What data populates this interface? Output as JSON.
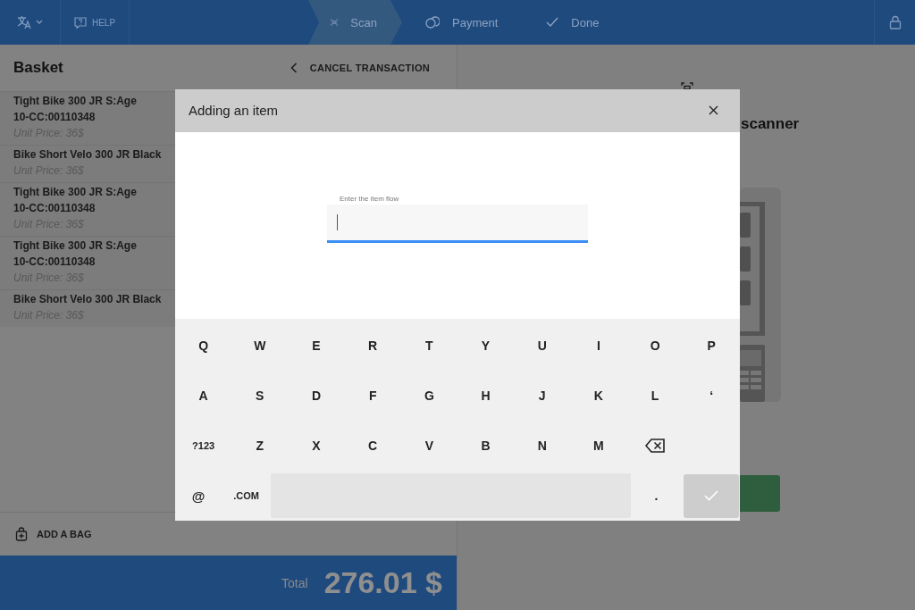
{
  "top_bar": {
    "language_button": {
      "kind": "language"
    },
    "help_button": {
      "label": "HELP"
    },
    "steps": [
      {
        "kind": "scan",
        "label": "Scan",
        "selected": true
      },
      {
        "kind": "payment",
        "label": "Payment",
        "selected": false
      },
      {
        "kind": "done",
        "label": "Done",
        "selected": false
      }
    ],
    "lock_button": {
      "kind": "lock"
    }
  },
  "basket": {
    "title": "Basket",
    "cancel": "CANCEL TRANSACTION",
    "items": [
      {
        "name": "Tight Bike 300 JR S:Age\n10-CC:00110348",
        "price": "Unit Price: 36$"
      },
      {
        "name": "Bike Short Velo 300 JR Black",
        "price": "Unit Price: 36$"
      },
      {
        "name": "Tight Bike 300 JR S:Age\n10-CC:00110348",
        "price": "Unit Price: 36$"
      },
      {
        "name": "Tight Bike 300 JR S:Age\n10-CC:00110348",
        "price": "Unit Price: 36$"
      },
      {
        "name": "Bike Short Velo 300 JR Black",
        "price": "Unit Price: 36$"
      }
    ],
    "add_bag": "ADD A BAG",
    "total_label": "Total",
    "total": "276.01 $"
  },
  "scan_panel": {
    "title": "scanner"
  },
  "dialog": {
    "title": "Adding an item",
    "field": {
      "label": "Enter the item flow",
      "focused": true
    },
    "keyboard": {
      "rows": [
        [
          {
            "kind": "char",
            "label": "Q"
          },
          {
            "kind": "char",
            "label": "W"
          },
          {
            "kind": "char",
            "label": "E"
          },
          {
            "kind": "char",
            "label": "R"
          },
          {
            "kind": "char",
            "label": "T"
          },
          {
            "kind": "char",
            "label": "Y"
          },
          {
            "kind": "char",
            "label": "U"
          },
          {
            "kind": "char",
            "label": "I"
          },
          {
            "kind": "char",
            "label": "O"
          },
          {
            "kind": "char",
            "label": "P"
          }
        ],
        [
          {
            "kind": "char",
            "label": "A"
          },
          {
            "kind": "char",
            "label": "S"
          },
          {
            "kind": "char",
            "label": "D"
          },
          {
            "kind": "char",
            "label": "F"
          },
          {
            "kind": "char",
            "label": "G"
          },
          {
            "kind": "char",
            "label": "H"
          },
          {
            "kind": "char",
            "label": "J"
          },
          {
            "kind": "char",
            "label": "K"
          },
          {
            "kind": "char",
            "label": "L"
          },
          {
            "kind": "char",
            "label": "‘"
          }
        ],
        [
          {
            "kind": "mode",
            "label": "?123"
          },
          {
            "kind": "char",
            "label": "Z"
          },
          {
            "kind": "char",
            "label": "X"
          },
          {
            "kind": "char",
            "label": "C"
          },
          {
            "kind": "char",
            "label": "V"
          },
          {
            "kind": "char",
            "label": "B"
          },
          {
            "kind": "char",
            "label": "N"
          },
          {
            "kind": "char",
            "label": "M"
          },
          {
            "kind": "backspace"
          }
        ]
      ],
      "bottom_keys": [
        {
          "kind": "char",
          "label": "@"
        },
        {
          "kind": "mode",
          "label": ".COM"
        },
        {
          "kind": "space"
        },
        {
          "kind": "dot",
          "label": "."
        },
        {
          "kind": "enter",
          "disabled": true
        }
      ]
    }
  }
}
